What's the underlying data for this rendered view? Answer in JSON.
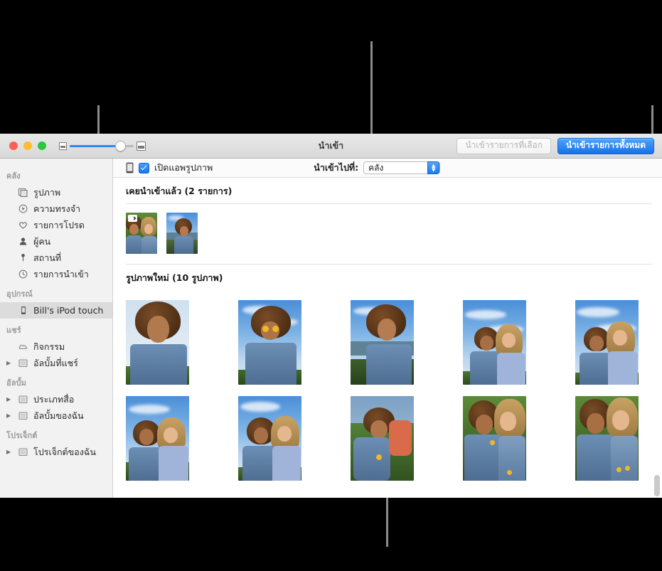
{
  "window": {
    "title": "นำเข้า",
    "traffic_lights": [
      "close-red",
      "minimize-yellow",
      "zoom-green"
    ],
    "zoom_slider": {
      "small_icon": "small-thumbnail-icon",
      "large_icon": "large-thumbnail-icon"
    },
    "toolbar": {
      "import_selected_label": "นำเข้ารายการที่เลือก",
      "import_all_label": "นำเข้ารายการทั้งหมด"
    }
  },
  "options_bar": {
    "device_icon": "iphone-icon",
    "open_photos_app_label": "เปิดแอพรูปภาพ",
    "open_photos_app_checked": true,
    "import_to_label": "นำเข้าไปที่:",
    "import_to_value": "คลัง",
    "import_to_options": [
      "คลัง"
    ]
  },
  "sidebar": {
    "groups": [
      {
        "header": "คลัง",
        "items": [
          {
            "label": "รูปภาพ",
            "icon": "photos-icon",
            "disclosure": false,
            "selected": false
          },
          {
            "label": "ความทรงจำ",
            "icon": "memories-icon",
            "disclosure": false,
            "selected": false
          },
          {
            "label": "รายการโปรด",
            "icon": "heart-icon",
            "disclosure": false,
            "selected": false
          },
          {
            "label": "ผู้คน",
            "icon": "person-icon",
            "disclosure": false,
            "selected": false
          },
          {
            "label": "สถานที่",
            "icon": "pin-icon",
            "disclosure": false,
            "selected": false
          },
          {
            "label": "รายการนำเข้า",
            "icon": "clock-icon",
            "disclosure": false,
            "selected": false
          }
        ]
      },
      {
        "header": "อุปกรณ์",
        "items": [
          {
            "label": "Bill's iPod touch",
            "icon": "ipod-icon",
            "disclosure": false,
            "selected": true
          }
        ]
      },
      {
        "header": "แชร์",
        "items": [
          {
            "label": "กิจกรรม",
            "icon": "cloud-icon",
            "disclosure": false,
            "selected": false
          },
          {
            "label": "อัลบั้มที่แชร์",
            "icon": "album-icon",
            "disclosure": true,
            "selected": false
          }
        ]
      },
      {
        "header": "อัลบั้ม",
        "items": [
          {
            "label": "ประเภทสื่อ",
            "icon": "album-icon",
            "disclosure": true,
            "selected": false
          },
          {
            "label": "อัลบั้มของฉัน",
            "icon": "album-icon",
            "disclosure": true,
            "selected": false
          }
        ]
      },
      {
        "header": "โปรเจ็กต์",
        "items": [
          {
            "label": "โปรเจ็กต์ของฉัน",
            "icon": "album-icon",
            "disclosure": true,
            "selected": false
          }
        ]
      }
    ]
  },
  "content": {
    "already_imported": {
      "title": "เคยนำเข้าแล้ว (2 รายการ)",
      "count": 2,
      "items": [
        {
          "kind": "video",
          "alt": "two-girls-lying-on-grass"
        },
        {
          "kind": "photo",
          "alt": "girl-at-beach"
        }
      ]
    },
    "new_photos": {
      "title": "รูปภาพใหม่ (10 รูปภาพ)",
      "count": 10,
      "rows": [
        [
          {
            "alt": "girl-looking-up"
          },
          {
            "alt": "girl-holding-flowers-over-eyes"
          },
          {
            "alt": "girl-smiling-at-coast"
          },
          {
            "alt": "two-friends-sunglasses-sky"
          },
          {
            "alt": "two-friends-sunglasses-sky-2"
          }
        ],
        [
          {
            "alt": "two-friends-on-grass"
          },
          {
            "alt": "friends-peace-sign"
          },
          {
            "alt": "girl-upside-down-on-grass"
          },
          {
            "alt": "friends-lying-on-grass"
          },
          {
            "alt": "friends-lying-on-grass-2"
          }
        ]
      ]
    }
  },
  "callouts": {
    "count": 4,
    "targets": [
      "sidebar-bracket",
      "import-to-popup",
      "import-all-button",
      "photo-grid-bracket"
    ],
    "color": "#8c8c8c"
  }
}
